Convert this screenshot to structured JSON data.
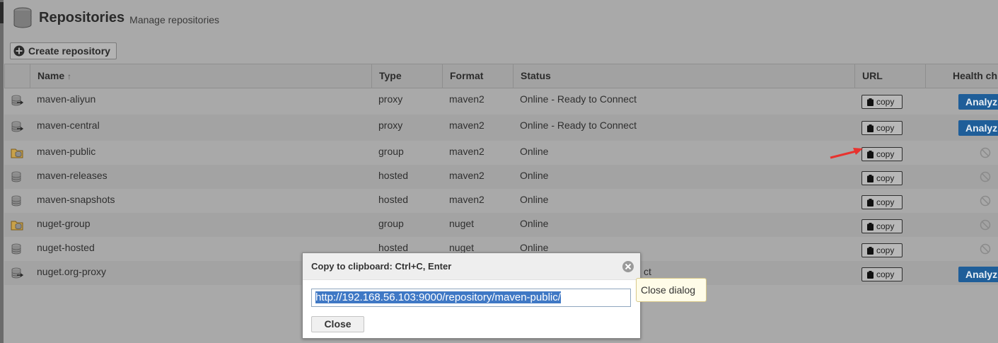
{
  "header": {
    "title": "Repositories",
    "subtitle": "Manage repositories",
    "icon": "database-icon"
  },
  "toolbar": {
    "create_label": "Create repository"
  },
  "columns": {
    "name": "Name",
    "sort_indicator": "↑",
    "type": "Type",
    "format": "Format",
    "status": "Status",
    "url": "URL",
    "health": "Health ch"
  },
  "rows": [
    {
      "icon": "proxy-repo-icon",
      "name": "maven-aliyun",
      "type": "proxy",
      "format": "maven2",
      "status": "Online - Ready to Connect",
      "url_button": "copy",
      "health": "Analyz"
    },
    {
      "icon": "proxy-repo-icon",
      "name": "maven-central",
      "type": "proxy",
      "format": "maven2",
      "status": "Online - Ready to Connect",
      "url_button": "copy",
      "health": "Analyz"
    },
    {
      "icon": "group-repo-icon",
      "name": "maven-public",
      "type": "group",
      "format": "maven2",
      "status": "Online",
      "url_button": "copy",
      "health": ""
    },
    {
      "icon": "hosted-repo-icon",
      "name": "maven-releases",
      "type": "hosted",
      "format": "maven2",
      "status": "Online",
      "url_button": "copy",
      "health": ""
    },
    {
      "icon": "hosted-repo-icon",
      "name": "maven-snapshots",
      "type": "hosted",
      "format": "maven2",
      "status": "Online",
      "url_button": "copy",
      "health": ""
    },
    {
      "icon": "group-repo-icon",
      "name": "nuget-group",
      "type": "group",
      "format": "nuget",
      "status": "Online",
      "url_button": "copy",
      "health": ""
    },
    {
      "icon": "hosted-repo-icon",
      "name": "nuget-hosted",
      "type": "hosted",
      "format": "nuget",
      "status": "Online",
      "url_button": "copy",
      "health": ""
    },
    {
      "icon": "proxy-repo-icon",
      "name": "nuget.org-proxy",
      "type": "",
      "format": "",
      "status": "ct",
      "url_button": "copy",
      "health": "Analyz"
    }
  ],
  "dialog": {
    "title": "Copy to clipboard: Ctrl+C, Enter",
    "url_value": "http://192.168.56.103:9000/repository/maven-public/",
    "close_label": "Close",
    "close_tooltip": "Close dialog"
  },
  "colors": {
    "analyze_button": "#1f5e99",
    "selection": "#3f78c5",
    "annotation_arrow": "#e8322e"
  }
}
